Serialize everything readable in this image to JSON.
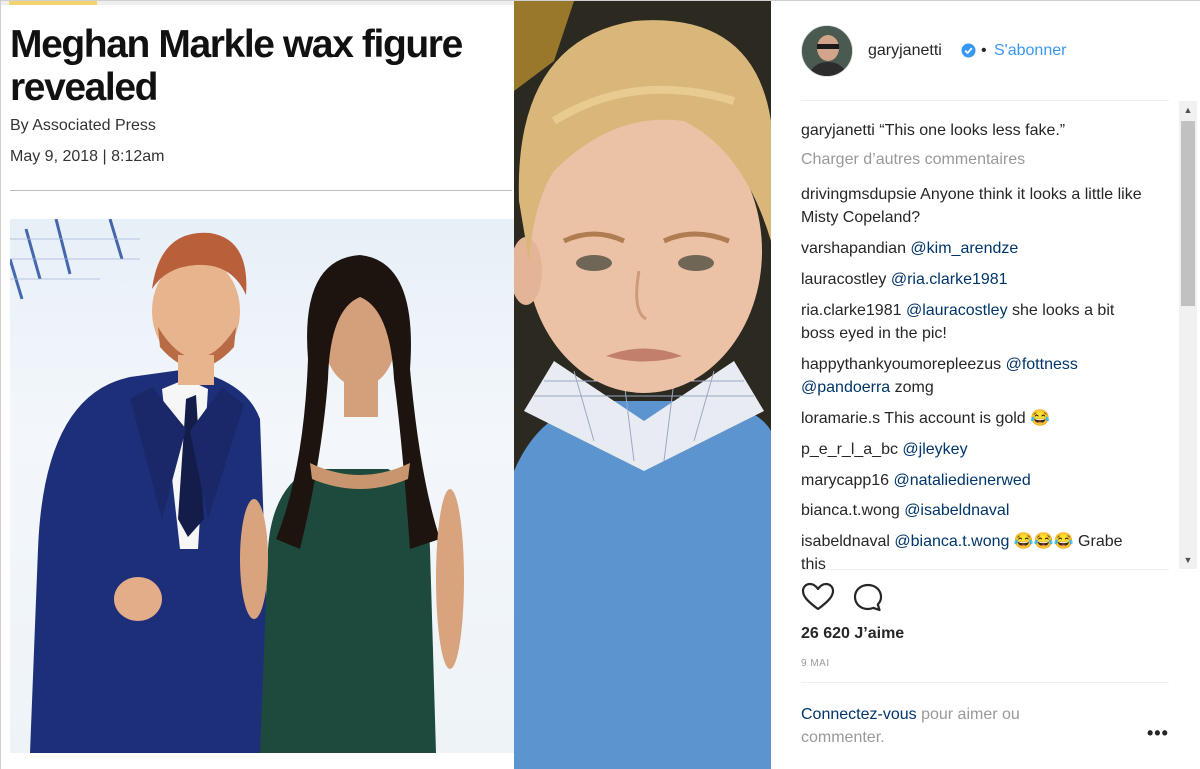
{
  "article": {
    "headline": "Meghan Markle wax figure revealed",
    "byline": "By Associated Press",
    "date": "May 9, 2018 | 8:12am"
  },
  "post": {
    "username": "garyjanetti",
    "separator": "•",
    "follow_label": "S'abonner",
    "comments": [
      {
        "user": "garyjanetti",
        "text": "“This one looks less fake.”",
        "mentions": []
      },
      {
        "user": "drivingmsdupsie",
        "text": "Anyone think it looks a little like Misty Copeland?",
        "mentions": []
      },
      {
        "user": "varshapandian",
        "text": "",
        "mentions": [
          "@kim_arendze"
        ]
      },
      {
        "user": "lauracostley",
        "text": "",
        "mentions": [
          "@ria.clarke1981"
        ]
      },
      {
        "user": "ria.clarke1981",
        "text": "she looks a bit boss eyed in the pic!",
        "mentions": [
          "@lauracostley"
        ]
      },
      {
        "user": "happythankyoumorepleezus",
        "text": "zomg",
        "mentions": [
          "@fottness",
          "@pandoerra"
        ]
      },
      {
        "user": "loramarie.s",
        "text": "This account is gold 😂",
        "mentions": []
      },
      {
        "user": "p_e_r_l_a_bc",
        "text": "",
        "mentions": [
          "@jleykey"
        ]
      },
      {
        "user": "marycapp16",
        "text": "",
        "mentions": [
          "@nataliedienerwed"
        ]
      },
      {
        "user": "bianca.t.wong",
        "text": "",
        "mentions": [
          "@isabeldnaval"
        ]
      },
      {
        "user": "isabeldnaval",
        "text": "😂😂😂 Grabe this",
        "mentions": [
          "@bianca.t.wong"
        ]
      }
    ],
    "load_more_label": "Charger d’autres commentaires",
    "likes_count": "26 620",
    "likes_label": "J’aime",
    "date": "9 MAI",
    "login_link": "Connectez-vous",
    "login_text": "pour aimer ou commenter.",
    "more_options": "•••",
    "icons": {
      "like": "heart-icon",
      "comment": "comment-bubble-icon",
      "verified": "verified-badge-icon",
      "more": "more-options-icon"
    }
  },
  "colors": {
    "link_blue": "#3897f0",
    "mention_navy": "#003569",
    "muted_gray": "#999999",
    "text": "#262626"
  }
}
